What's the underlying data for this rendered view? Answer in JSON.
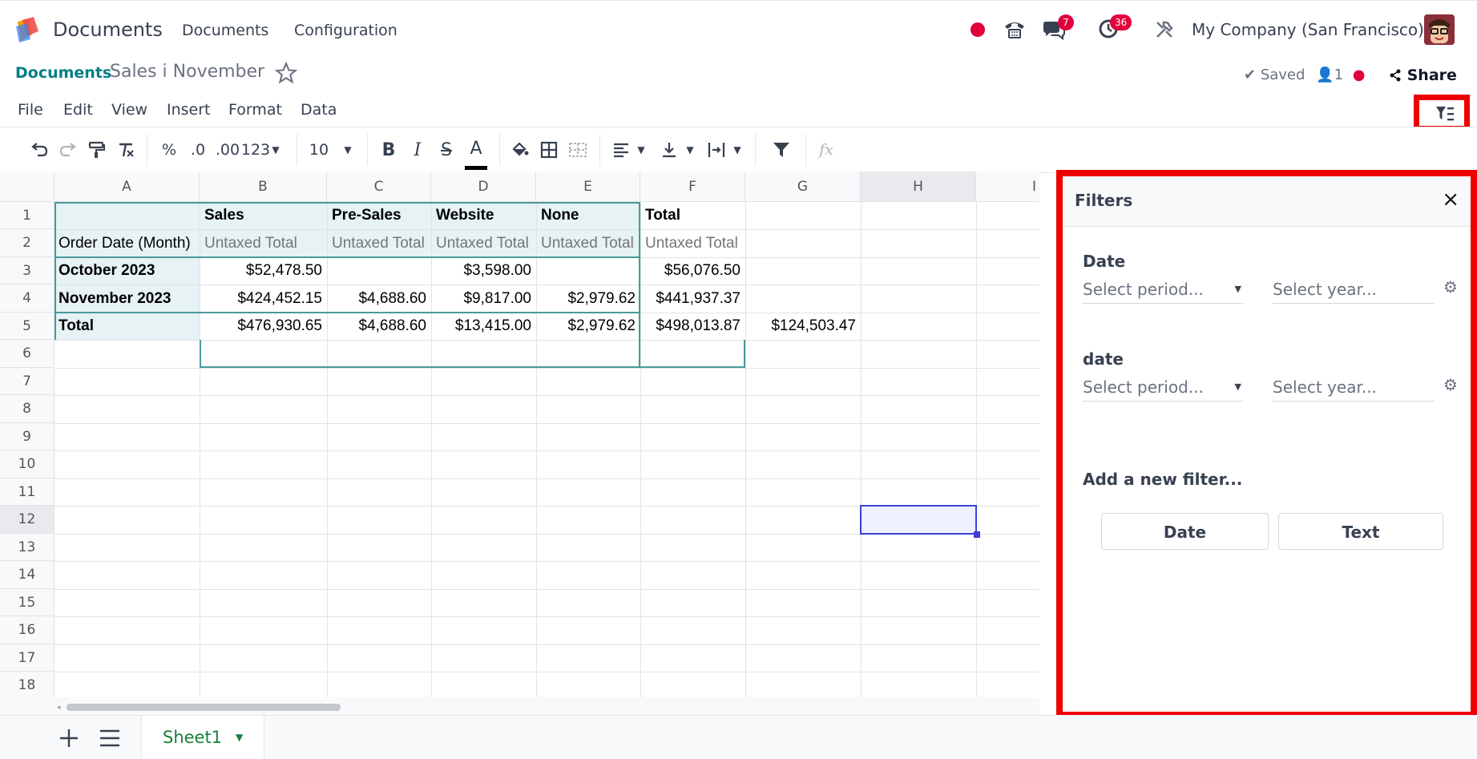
{
  "app": {
    "name": "Documents"
  },
  "topnav": {
    "menu": [
      "Documents",
      "Configuration"
    ],
    "chat_count": "7",
    "activity_count": "36",
    "company": "My Company (San Francisco)"
  },
  "breadcrumb": {
    "parent": "Documents",
    "title": "Sales i November"
  },
  "status": {
    "saved": "Saved",
    "users": "1",
    "share": "Share"
  },
  "menubar": [
    "File",
    "Edit",
    "View",
    "Insert",
    "Format",
    "Data"
  ],
  "toolbar": {
    "percent": "%",
    "dec_less": ".0",
    "dec_more": ".00",
    "number_format": "123",
    "font_size": "10",
    "bold": "B",
    "italic": "I",
    "strike": "S",
    "text_color": "A",
    "fx": "fx"
  },
  "columns": [
    "A",
    "B",
    "C",
    "D",
    "E",
    "F",
    "G",
    "H",
    "I"
  ],
  "rows": [
    "1",
    "2",
    "3",
    "4",
    "5",
    "6",
    "7",
    "8",
    "9",
    "10",
    "11",
    "12",
    "13",
    "14",
    "15",
    "16",
    "17",
    "18"
  ],
  "pivot": {
    "header1": [
      "",
      "Sales",
      "Pre-Sales",
      "Website",
      "None",
      "Total"
    ],
    "header2": [
      "Order Date (Month)",
      "Untaxed Total",
      "Untaxed Total",
      "Untaxed Total",
      "Untaxed Total",
      "Untaxed Total"
    ],
    "body": [
      [
        "October 2023",
        "$52,478.50",
        "",
        "$3,598.00",
        "",
        "$56,076.50"
      ],
      [
        "November 2023",
        "$424,452.15",
        "$4,688.60",
        "$9,817.00",
        "$2,979.62",
        "$441,937.37"
      ],
      [
        "Total",
        "$476,930.65",
        "$4,688.60",
        "$13,415.00",
        "$2,979.62",
        "$498,013.87"
      ]
    ],
    "g5": "$124,503.47"
  },
  "filters_panel": {
    "title": "Filters",
    "close": "×",
    "groups": [
      {
        "label": "Date",
        "period_placeholder": "Select period...",
        "year_placeholder": "Select year..."
      },
      {
        "label": "date",
        "period_placeholder": "Select period...",
        "year_placeholder": "Select year..."
      }
    ],
    "add_label": "Add a new filter...",
    "add_buttons": [
      "Date",
      "Text"
    ]
  },
  "sheets": {
    "active": "Sheet1"
  },
  "colors": {
    "accent": "#017e84",
    "highlight": "#ee0000",
    "badge": "#e0003c",
    "sheet_tab": "#188038"
  }
}
